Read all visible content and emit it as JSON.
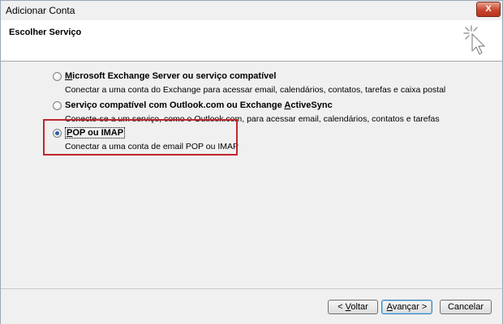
{
  "window": {
    "title": "Adicionar Conta",
    "close_label": "X"
  },
  "header": {
    "title": "Escolher Serviço",
    "icon": "wizard-cursor-icon"
  },
  "options": [
    {
      "label_prefix": "",
      "label_access": "M",
      "label_rest": "icrosoft Exchange Server ou serviço compatível",
      "description": "Conectar a uma conta do Exchange para acessar email, calendários, contatos, tarefas e caixa postal",
      "selected": false
    },
    {
      "label_prefix": "Serviço compatível com Outlook.com ou Exchange ",
      "label_access": "A",
      "label_rest": "ctiveSync",
      "description": "Conecte-se a um serviço, como o Outlook.com, para acessar email, calendários, contatos e tarefas",
      "selected": false
    },
    {
      "label_prefix": "",
      "label_access": "P",
      "label_rest": "OP ou IMAP",
      "description": "Conectar a uma conta de email POP ou IMAP",
      "selected": true
    }
  ],
  "buttons": {
    "back_prefix": "< ",
    "back_access": "V",
    "back_rest": "oltar",
    "next_access": "A",
    "next_rest": "vançar >",
    "cancel": "Cancelar"
  },
  "colors": {
    "highlight": "#c0272d",
    "radio_selected": "#2b5fa8"
  }
}
